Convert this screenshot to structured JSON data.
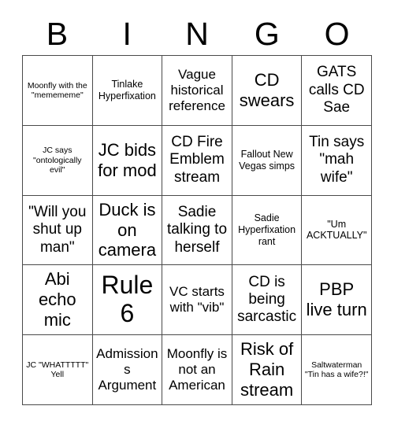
{
  "card": {
    "title": "BINGO",
    "header_letters": [
      "B",
      "I",
      "N",
      "G",
      "O"
    ],
    "rows": 5,
    "columns": 5,
    "border_color": "#4a4a4a",
    "background_color": "#ffffff",
    "text_color": "#000000"
  },
  "cells": [
    {
      "id": "b1",
      "column": "B",
      "row": 1,
      "text": "Moonfly with the \"memememe\"",
      "size": "xs",
      "marked": false
    },
    {
      "id": "i1",
      "column": "I",
      "row": 1,
      "text": "Tinlake Hyperfixation",
      "size": "sm",
      "marked": false
    },
    {
      "id": "n1",
      "column": "N",
      "row": 1,
      "text": "Vague historical reference",
      "size": "md",
      "marked": false
    },
    {
      "id": "g1",
      "column": "G",
      "row": 1,
      "text": "CD swears",
      "size": "xl",
      "marked": false
    },
    {
      "id": "o1",
      "column": "O",
      "row": 1,
      "text": "GATS calls CD Sae",
      "size": "lg",
      "marked": false
    },
    {
      "id": "b2",
      "column": "B",
      "row": 2,
      "text": "JC says \"ontologically evil\"",
      "size": "xs",
      "marked": false
    },
    {
      "id": "i2",
      "column": "I",
      "row": 2,
      "text": "JC bids for mod",
      "size": "xl",
      "marked": false
    },
    {
      "id": "n2",
      "column": "N",
      "row": 2,
      "text": "CD Fire Emblem stream",
      "size": "lg",
      "marked": false
    },
    {
      "id": "g2",
      "column": "G",
      "row": 2,
      "text": "Fallout New Vegas simps",
      "size": "sm",
      "marked": false
    },
    {
      "id": "o2",
      "column": "O",
      "row": 2,
      "text": "Tin says \"mah wife\"",
      "size": "lg",
      "marked": false
    },
    {
      "id": "b3",
      "column": "B",
      "row": 3,
      "text": "\"Will you shut up man\"",
      "size": "lg",
      "marked": false
    },
    {
      "id": "i3",
      "column": "I",
      "row": 3,
      "text": "Duck is on camera",
      "size": "xl",
      "marked": false
    },
    {
      "id": "n3",
      "column": "N",
      "row": 3,
      "text": "Sadie talking to herself",
      "size": "lg",
      "marked": false
    },
    {
      "id": "g3",
      "column": "G",
      "row": 3,
      "text": "Sadie Hyperfixation rant",
      "size": "sm",
      "marked": false
    },
    {
      "id": "o3",
      "column": "O",
      "row": 3,
      "text": "\"Um ACKTUALLY\"",
      "size": "sm",
      "marked": false
    },
    {
      "id": "b4",
      "column": "B",
      "row": 4,
      "text": "Abi echo mic",
      "size": "xl",
      "marked": false
    },
    {
      "id": "i4",
      "column": "I",
      "row": 4,
      "text": "Rule 6",
      "size": "xxl",
      "marked": false
    },
    {
      "id": "n4",
      "column": "N",
      "row": 4,
      "text": "VC starts with \"vib\"",
      "size": "md",
      "marked": false
    },
    {
      "id": "g4",
      "column": "G",
      "row": 4,
      "text": "CD is being sarcastic",
      "size": "lg",
      "marked": false
    },
    {
      "id": "o4",
      "column": "O",
      "row": 4,
      "text": "PBP live turn",
      "size": "xl",
      "marked": false
    },
    {
      "id": "b5",
      "column": "B",
      "row": 5,
      "text": "JC \"WHATTTTT\" Yell",
      "size": "xs",
      "marked": false
    },
    {
      "id": "i5",
      "column": "I",
      "row": 5,
      "text": "Admissions Argument",
      "size": "md",
      "marked": false
    },
    {
      "id": "n5",
      "column": "N",
      "row": 5,
      "text": "Moonfly is not an American",
      "size": "md",
      "marked": false
    },
    {
      "id": "g5",
      "column": "G",
      "row": 5,
      "text": "Risk of Rain stream",
      "size": "xl",
      "marked": false
    },
    {
      "id": "o5",
      "column": "O",
      "row": 5,
      "text": "Saltwaterman \"Tin has a wife?!\"",
      "size": "xs",
      "marked": false
    }
  ]
}
